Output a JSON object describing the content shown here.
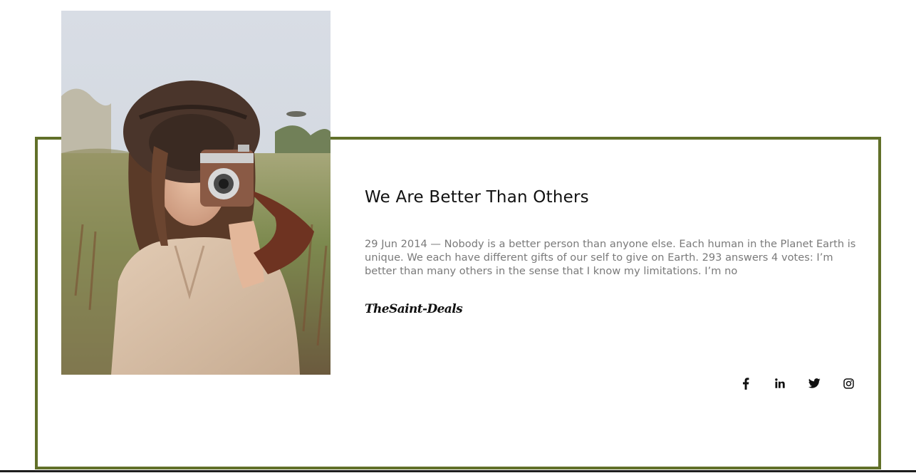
{
  "colors": {
    "frame_border": "#617029",
    "title": "#111111",
    "body_text": "#7a7a7a"
  },
  "photo": {
    "alt": "Woman in a hat holding a vintage camera in a grass field"
  },
  "content": {
    "title": "We Are Better Than Others",
    "body": "29 Jun 2014 — Nobody is a better person than anyone else. Each human in the Planet Earth is unique. We each have different gifts of our self to give on Earth. 293 answers 4 votes: I’m better than many others in the sense that I know my limitations. I’m no",
    "signature": "TheSaint-Deals"
  },
  "social_links": [
    {
      "name": "facebook",
      "icon": "facebook-icon"
    },
    {
      "name": "linkedin",
      "icon": "linkedin-icon"
    },
    {
      "name": "twitter",
      "icon": "twitter-icon"
    },
    {
      "name": "instagram",
      "icon": "instagram-icon"
    }
  ]
}
